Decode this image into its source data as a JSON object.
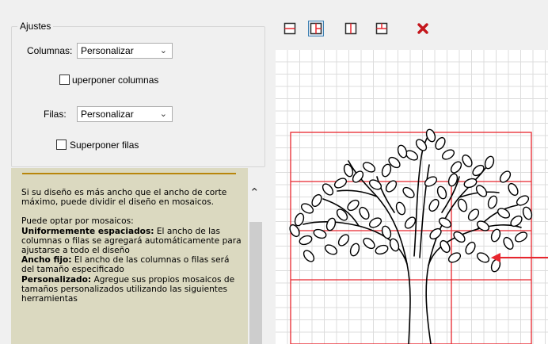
{
  "settings": {
    "legend": "Ajustes",
    "columns_label": "Columnas:",
    "columns_value": "Personalizar",
    "overlap_columns_label": "uperponer columnas",
    "rows_label": "Filas:",
    "rows_value": "Personalizar",
    "overlap_rows_label": "Superponer filas"
  },
  "help": {
    "p1": "Si su diseño es más ancho que el ancho de corte máximo, puede dividir el diseño en mosaicos.",
    "intro": "Puede optar por mosaicos:",
    "opt1_title": "Uniformemente espaciados:",
    "opt1_text": " El ancho de las columnas o filas se agregará automáticamente para ajustarse a todo el diseño",
    "opt2_title": "Ancho fijo:",
    "opt2_text": " El ancho de las columnas o filas será del tamaño especificado",
    "opt3_title": "Personalizado:",
    "opt3_text": " Agregue sus propios mosaicos de tamaños personalizados utilizando las siguientes herramientas"
  },
  "toolbar": {
    "buttons": [
      "split-rows-icon",
      "split-columns-selected-icon",
      "split-columns-icon",
      "split-quadrant-icon",
      "delete-icon"
    ]
  },
  "colors": {
    "grid": "#dcdcdc",
    "tile_lines": "#e8262e",
    "arrow": "#e8262e",
    "help_bg": "#dbd9c0",
    "help_rule": "#b8860b"
  }
}
